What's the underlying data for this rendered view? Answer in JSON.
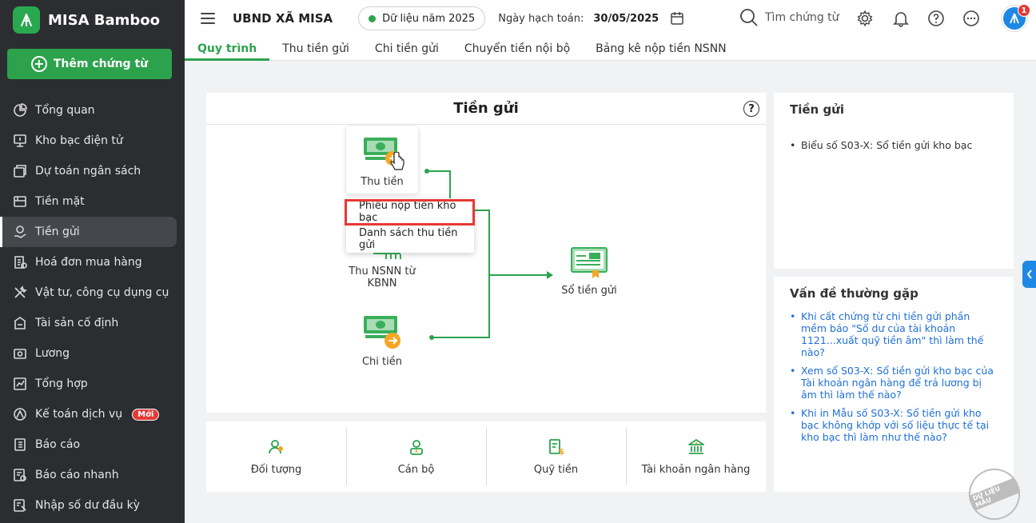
{
  "brand": {
    "name": "MISA Bamboo"
  },
  "sidebar": {
    "add_button": "Thêm chứng từ",
    "items": [
      {
        "label": "Tổng quan",
        "icon": "pie-chart-icon"
      },
      {
        "label": "Kho bạc điện tử",
        "icon": "monitor-icon"
      },
      {
        "label": "Dự toán ngân sách",
        "icon": "budget-icon"
      },
      {
        "label": "Tiền mặt",
        "icon": "cash-icon"
      },
      {
        "label": "Tiền gửi",
        "icon": "deposit-icon",
        "active": true
      },
      {
        "label": "Hoá đơn mua hàng",
        "icon": "invoice-icon"
      },
      {
        "label": "Vật tư, công cụ dụng cụ",
        "icon": "tools-icon"
      },
      {
        "label": "Tài sản cố định",
        "icon": "asset-icon"
      },
      {
        "label": "Lương",
        "icon": "salary-icon"
      },
      {
        "label": "Tổng hợp",
        "icon": "summary-icon"
      },
      {
        "label": "Kế toán dịch vụ",
        "icon": "service-icon",
        "badge": "Mới"
      },
      {
        "label": "Báo cáo",
        "icon": "report-icon"
      },
      {
        "label": "Báo cáo nhanh",
        "icon": "quick-report-icon"
      },
      {
        "label": "Nhập số dư đầu kỳ",
        "icon": "opening-balance-icon"
      }
    ]
  },
  "header": {
    "org": "UBND XÃ MISA",
    "year": "Dữ liệu năm 2025",
    "post_label": "Ngày hạch toán:",
    "post_date": "30/05/2025",
    "search": "Tìm chứng từ",
    "notif_count": "1"
  },
  "tabs": [
    "Quy trình",
    "Thu tiền gửi",
    "Chi tiền gửi",
    "Chuyển tiền nội bộ",
    "Bảng kê nộp tiền NSNN"
  ],
  "flow": {
    "title": "Tiền gửi",
    "help": "?",
    "thu_tien": "Thu tiền",
    "thu_nsnn": "Thu NSNN từ KBNN",
    "chi_tien": "Chi tiền",
    "so_tien_gui": "Sổ tiền gửi",
    "dropdown": [
      "Phiếu nộp tiền kho bạc",
      "Danh sách thu tiền gửi"
    ]
  },
  "shortcuts": [
    "Đối tượng",
    "Cán bộ",
    "Quỹ tiền",
    "Tài khoản ngân hàng"
  ],
  "right": {
    "reports_title": "Tiền gửi",
    "reports": [
      "Biểu số S03-X: Sổ tiền gửi kho bạc"
    ],
    "faq_title": "Vấn đề thường gặp",
    "faq": [
      "Khi cất chứng từ chi tiền gửi phần mềm báo \"Số dư của tài khoản 1121...xuất quỹ tiền âm\" thì làm thế nào?",
      "Xem sổ S03-X: Sổ tiền gửi kho bạc của Tài khoản ngân hàng để trả lương bị âm thì làm thế nào?",
      "Khi in Mẫu số S03-X: Sổ tiền gửi kho bạc không khớp với số liệu thực tế tại kho bạc thì làm như thế nào?"
    ]
  },
  "watermark": "DỮ LIỆU MẪU",
  "colors": {
    "brand_green": "#2ca24d",
    "sidebar_bg": "#2b2d31",
    "link_blue": "#1e6fd9",
    "highlight_red": "#e53935"
  }
}
